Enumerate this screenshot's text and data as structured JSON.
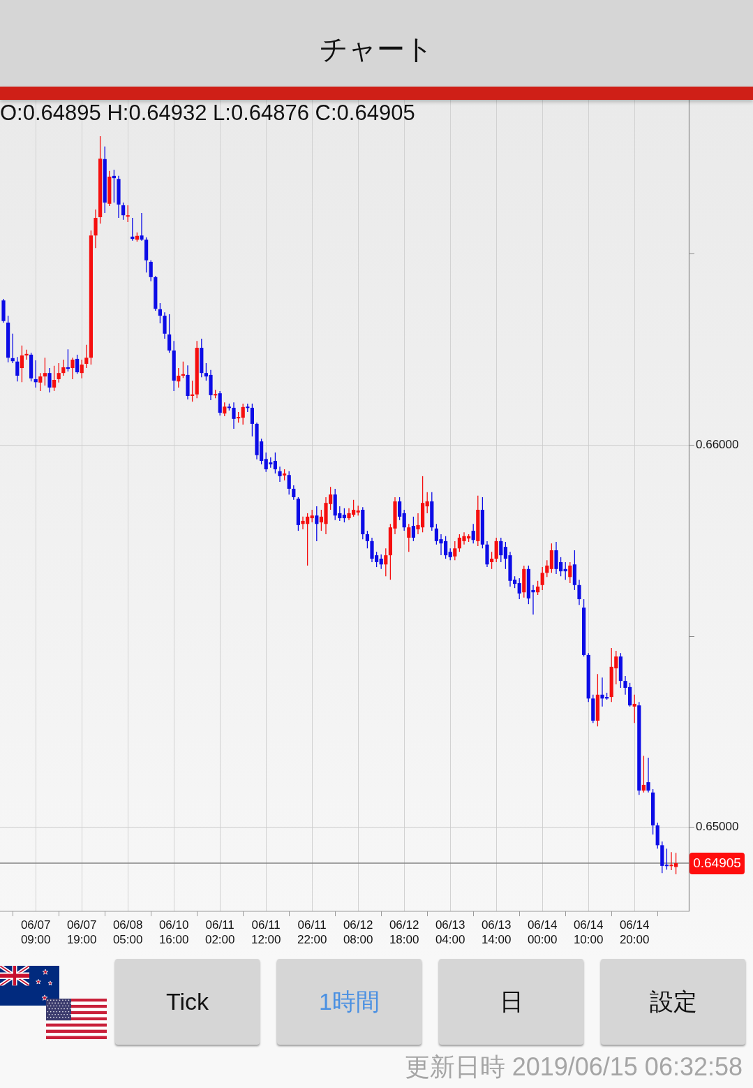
{
  "app_bar": {
    "title": "チャート"
  },
  "chart": {
    "ohlc_readout": "O:0.64895 H:0.64932 L:0.64876 C:0.64905",
    "current_price": "0.64905",
    "chart_data": {
      "type": "candlestick",
      "ylim": [
        0.64779,
        0.66903
      ],
      "yticks": [
        {
          "value": 0.66,
          "label": "0.66000"
        },
        {
          "value": 0.65,
          "label": "0.65000"
        }
      ],
      "ref_lines": [
        {
          "axis": "y",
          "value": 0.64905
        }
      ],
      "categories": [
        null,
        null,
        null,
        null,
        null,
        null,
        null,
        "06/07 09:00",
        null,
        null,
        null,
        null,
        null,
        null,
        null,
        null,
        null,
        "06/07 19:00",
        null,
        null,
        null,
        null,
        null,
        null,
        null,
        null,
        null,
        "06/08 05:00",
        null,
        null,
        null,
        null,
        null,
        null,
        null,
        null,
        null,
        "06/10 16:00",
        null,
        null,
        null,
        null,
        null,
        null,
        null,
        null,
        null,
        "06/11 02:00",
        null,
        null,
        null,
        null,
        null,
        null,
        null,
        null,
        null,
        "06/11 12:00",
        null,
        null,
        null,
        null,
        null,
        null,
        null,
        null,
        null,
        "06/11 22:00",
        null,
        null,
        null,
        null,
        null,
        null,
        null,
        null,
        null,
        "06/12 08:00",
        null,
        null,
        null,
        null,
        null,
        null,
        null,
        null,
        null,
        "06/12 18:00",
        null,
        null,
        null,
        null,
        null,
        null,
        null,
        null,
        null,
        "06/13 04:00",
        null,
        null,
        null,
        null,
        null,
        null,
        null,
        null,
        null,
        "06/13 14:00",
        null,
        null,
        null,
        null,
        null,
        null,
        null,
        null,
        null,
        "06/14 00:00",
        null,
        null,
        null,
        null,
        null,
        null,
        null,
        null,
        null,
        "06/14 10:00",
        null,
        null,
        null,
        null,
        null,
        null,
        null,
        null,
        null,
        "06/14 20:00",
        null,
        null,
        null,
        null,
        null,
        null,
        null,
        null,
        null
      ],
      "ohlc": [
        [
          0.66378,
          0.66382,
          0.6632,
          0.66324
        ],
        [
          0.6632,
          0.66338,
          0.66216,
          0.66228
        ],
        [
          0.66227,
          0.66291,
          0.66214,
          0.66219
        ],
        [
          0.66218,
          0.6623,
          0.66166,
          0.66181
        ],
        [
          0.66201,
          0.6626,
          0.66164,
          0.66234
        ],
        [
          0.66234,
          0.66249,
          0.66223,
          0.66238
        ],
        [
          0.66236,
          0.66241,
          0.66166,
          0.66174
        ],
        [
          0.66172,
          0.66221,
          0.6615,
          0.66164
        ],
        [
          0.66163,
          0.66188,
          0.66141,
          0.66179
        ],
        [
          0.66179,
          0.66228,
          0.66155,
          0.66188
        ],
        [
          0.66188,
          0.66201,
          0.66137,
          0.6615
        ],
        [
          0.6615,
          0.66207,
          0.66141,
          0.6617
        ],
        [
          0.66172,
          0.66214,
          0.66163,
          0.66188
        ],
        [
          0.66188,
          0.66223,
          0.66181,
          0.66203
        ],
        [
          0.66203,
          0.6625,
          0.66192,
          0.66199
        ],
        [
          0.66201,
          0.66228,
          0.66172,
          0.66223
        ],
        [
          0.66225,
          0.66236,
          0.66186,
          0.6619
        ],
        [
          0.66188,
          0.66223,
          0.66174,
          0.6621
        ],
        [
          0.66212,
          0.66262,
          0.66201,
          0.66228
        ],
        [
          0.66228,
          0.66561,
          0.6621,
          0.66548
        ],
        [
          0.66548,
          0.66616,
          0.66515,
          0.66594
        ],
        [
          0.66596,
          0.66808,
          0.66579,
          0.66749
        ],
        [
          0.66748,
          0.66781,
          0.66607,
          0.66634
        ],
        [
          0.66631,
          0.66717,
          0.66625,
          0.66702
        ],
        [
          0.66704,
          0.6672,
          0.66634,
          0.66698
        ],
        [
          0.66696,
          0.66704,
          0.66594,
          0.66629
        ],
        [
          0.66627,
          0.66634,
          0.66589,
          0.66601
        ],
        [
          0.66598,
          0.66627,
          0.66583,
          0.66601
        ],
        [
          0.66545,
          0.66594,
          0.66534,
          0.66539
        ],
        [
          0.66537,
          0.66556,
          0.66532,
          0.66547
        ],
        [
          0.66548,
          0.66607,
          0.66534,
          0.66537
        ],
        [
          0.66537,
          0.66543,
          0.66451,
          0.66483
        ],
        [
          0.66479,
          0.66483,
          0.66428,
          0.66439
        ],
        [
          0.66439,
          0.66442,
          0.66351,
          0.66356
        ],
        [
          0.66355,
          0.66371,
          0.66318,
          0.66338
        ],
        [
          0.66338,
          0.66347,
          0.66278,
          0.66291
        ],
        [
          0.66289,
          0.66342,
          0.66241,
          0.66247
        ],
        [
          0.66247,
          0.66272,
          0.66141,
          0.66168
        ],
        [
          0.66166,
          0.66201,
          0.6615,
          0.66181
        ],
        [
          0.66181,
          0.66218,
          0.66175,
          0.66185
        ],
        [
          0.66183,
          0.66208,
          0.66119,
          0.66128
        ],
        [
          0.66128,
          0.66168,
          0.66113,
          0.66132
        ],
        [
          0.66132,
          0.66272,
          0.66122,
          0.66254
        ],
        [
          0.66254,
          0.66278,
          0.66177,
          0.66188
        ],
        [
          0.66188,
          0.66214,
          0.66168,
          0.66179
        ],
        [
          0.66183,
          0.66196,
          0.66117,
          0.6613
        ],
        [
          0.6613,
          0.66144,
          0.66122,
          0.66133
        ],
        [
          0.66135,
          0.66141,
          0.66077,
          0.66084
        ],
        [
          0.66082,
          0.66111,
          0.66075,
          0.661
        ],
        [
          0.661,
          0.66108,
          0.6609,
          0.66097
        ],
        [
          0.66097,
          0.66111,
          0.66042,
          0.66068
        ],
        [
          0.6607,
          0.66086,
          0.66058,
          0.66073
        ],
        [
          0.66071,
          0.66108,
          0.66053,
          0.66099
        ],
        [
          0.661,
          0.66108,
          0.66086,
          0.66097
        ],
        [
          0.66097,
          0.66108,
          0.66022,
          0.66055
        ],
        [
          0.66055,
          0.66058,
          0.65962,
          0.65973
        ],
        [
          0.66009,
          0.66016,
          0.65949,
          0.65958
        ],
        [
          0.65963,
          0.6598,
          0.65929,
          0.65936
        ],
        [
          0.65954,
          0.65967,
          0.6594,
          0.65949
        ],
        [
          0.65958,
          0.6598,
          0.65925,
          0.65936
        ],
        [
          0.65931,
          0.65943,
          0.65903,
          0.65918
        ],
        [
          0.6592,
          0.65936,
          0.65907,
          0.65925
        ],
        [
          0.65921,
          0.65931,
          0.6587,
          0.65885
        ],
        [
          0.65885,
          0.65894,
          0.65856,
          0.65863
        ],
        [
          0.65859,
          0.65863,
          0.65775,
          0.6579
        ],
        [
          0.65793,
          0.65812,
          0.65779,
          0.65801
        ],
        [
          0.65793,
          0.65821,
          0.65684,
          0.65812
        ],
        [
          0.65808,
          0.6583,
          0.65797,
          0.65815
        ],
        [
          0.65815,
          0.65839,
          0.65748,
          0.65793
        ],
        [
          0.65797,
          0.6583,
          0.65775,
          0.65812
        ],
        [
          0.65793,
          0.65863,
          0.65766,
          0.65848
        ],
        [
          0.65845,
          0.6589,
          0.6583,
          0.6587
        ],
        [
          0.6587,
          0.65885,
          0.65803,
          0.65815
        ],
        [
          0.65821,
          0.65839,
          0.65801,
          0.65808
        ],
        [
          0.65817,
          0.65834,
          0.65797,
          0.65808
        ],
        [
          0.65808,
          0.65834,
          0.65803,
          0.65821
        ],
        [
          0.65817,
          0.65856,
          0.65812,
          0.6583
        ],
        [
          0.65823,
          0.65841,
          0.65815,
          0.65828
        ],
        [
          0.6583,
          0.65837,
          0.65753,
          0.65766
        ],
        [
          0.65766,
          0.65775,
          0.65729,
          0.65748
        ],
        [
          0.65748,
          0.65757,
          0.65693,
          0.65702
        ],
        [
          0.65711,
          0.6572,
          0.6568,
          0.65693
        ],
        [
          0.65702,
          0.65713,
          0.65675,
          0.65687
        ],
        [
          0.65687,
          0.65729,
          0.65656,
          0.65711
        ],
        [
          0.65711,
          0.65793,
          0.65647,
          0.65784
        ],
        [
          0.65781,
          0.65863,
          0.65766,
          0.65852
        ],
        [
          0.65852,
          0.65863,
          0.65803,
          0.65812
        ],
        [
          0.65821,
          0.6583,
          0.65775,
          0.65784
        ],
        [
          0.65757,
          0.65793,
          0.6572,
          0.65784
        ],
        [
          0.65788,
          0.65812,
          0.65748,
          0.65757
        ],
        [
          0.65779,
          0.65821,
          0.65766,
          0.6579
        ],
        [
          0.65784,
          0.65918,
          0.65771,
          0.65848
        ],
        [
          0.65839,
          0.65876,
          0.65821,
          0.65852
        ],
        [
          0.65852,
          0.65876,
          0.65775,
          0.65784
        ],
        [
          0.65781,
          0.65793,
          0.65739,
          0.65748
        ],
        [
          0.65753,
          0.65766,
          0.65711,
          0.65742
        ],
        [
          0.65748,
          0.65761,
          0.65702,
          0.65711
        ],
        [
          0.6572,
          0.65729,
          0.65698,
          0.65706
        ],
        [
          0.65708,
          0.65748,
          0.65698,
          0.65729
        ],
        [
          0.65729,
          0.65766,
          0.6572,
          0.65757
        ],
        [
          0.65748,
          0.65771,
          0.65739,
          0.65761
        ],
        [
          0.65755,
          0.65766,
          0.65746,
          0.65761
        ],
        [
          0.65775,
          0.65793,
          0.65742,
          0.65751
        ],
        [
          0.65748,
          0.65867,
          0.65735,
          0.6583
        ],
        [
          0.6583,
          0.65863,
          0.65729,
          0.65739
        ],
        [
          0.65739,
          0.65748,
          0.6568,
          0.65687
        ],
        [
          0.65693,
          0.6572,
          0.65675,
          0.65702
        ],
        [
          0.65702,
          0.65757,
          0.65693,
          0.65748
        ],
        [
          0.65748,
          0.65757,
          0.65693,
          0.65711
        ],
        [
          0.65733,
          0.65746,
          0.65675,
          0.65702
        ],
        [
          0.65711,
          0.6572,
          0.65629,
          0.65644
        ],
        [
          0.65647,
          0.65656,
          0.65625,
          0.65636
        ],
        [
          0.65638,
          0.65651,
          0.65596,
          0.65611
        ],
        [
          0.65614,
          0.65684,
          0.656,
          0.65675
        ],
        [
          0.65675,
          0.65684,
          0.65583,
          0.65598
        ],
        [
          0.6562,
          0.65633,
          0.65556,
          0.65614
        ],
        [
          0.65614,
          0.65644,
          0.65607,
          0.65629
        ],
        [
          0.65633,
          0.6568,
          0.6562,
          0.65665
        ],
        [
          0.65665,
          0.65698,
          0.65654,
          0.65684
        ],
        [
          0.65675,
          0.65742,
          0.65665,
          0.65724
        ],
        [
          0.65724,
          0.65746,
          0.65662,
          0.65675
        ],
        [
          0.65693,
          0.65706,
          0.65656,
          0.65669
        ],
        [
          0.65675,
          0.65693,
          0.65647,
          0.65669
        ],
        [
          0.65654,
          0.65693,
          0.65638,
          0.65684
        ],
        [
          0.65687,
          0.65724,
          0.6562,
          0.65633
        ],
        [
          0.65633,
          0.65647,
          0.65581,
          0.65596
        ],
        [
          0.65574,
          0.65596,
          0.65446,
          0.6545
        ],
        [
          0.6545,
          0.65455,
          0.65327,
          0.65336
        ],
        [
          0.65336,
          0.65346,
          0.65272,
          0.65278
        ],
        [
          0.65278,
          0.654,
          0.65263,
          0.65346
        ],
        [
          0.65346,
          0.65391,
          0.65315,
          0.65336
        ],
        [
          0.6534,
          0.65351,
          0.65333,
          0.65336
        ],
        [
          0.6534,
          0.65468,
          0.65327,
          0.65419
        ],
        [
          0.65415,
          0.65461,
          0.65373,
          0.65446
        ],
        [
          0.65446,
          0.65455,
          0.65364,
          0.65382
        ],
        [
          0.65382,
          0.65395,
          0.65346,
          0.65364
        ],
        [
          0.65366,
          0.65377,
          0.65315,
          0.65318
        ],
        [
          0.65315,
          0.65346,
          0.65272,
          0.65322
        ],
        [
          0.65318,
          0.65327,
          0.65084,
          0.65095
        ],
        [
          0.65095,
          0.65186,
          0.6509,
          0.6511
        ],
        [
          0.65117,
          0.65181,
          0.6509,
          0.65095
        ],
        [
          0.6509,
          0.65099,
          0.6498,
          0.65004
        ],
        [
          0.65004,
          0.65011,
          0.64943,
          0.64952
        ],
        [
          0.64952,
          0.64962,
          0.64879,
          0.64898
        ],
        [
          0.64901,
          0.64943,
          0.64888,
          0.64898
        ],
        [
          0.64898,
          0.64934,
          0.64887,
          0.64901
        ],
        [
          0.64895,
          0.64932,
          0.64876,
          0.64905
        ]
      ]
    }
  },
  "timeframes": [
    {
      "label": "Tick",
      "selected": false
    },
    {
      "label": "1時間",
      "selected": true
    },
    {
      "label": "日",
      "selected": false
    }
  ],
  "settings_button": {
    "label": "設定"
  },
  "last_updated": "更新日時 2019/06/15 06:32:58"
}
